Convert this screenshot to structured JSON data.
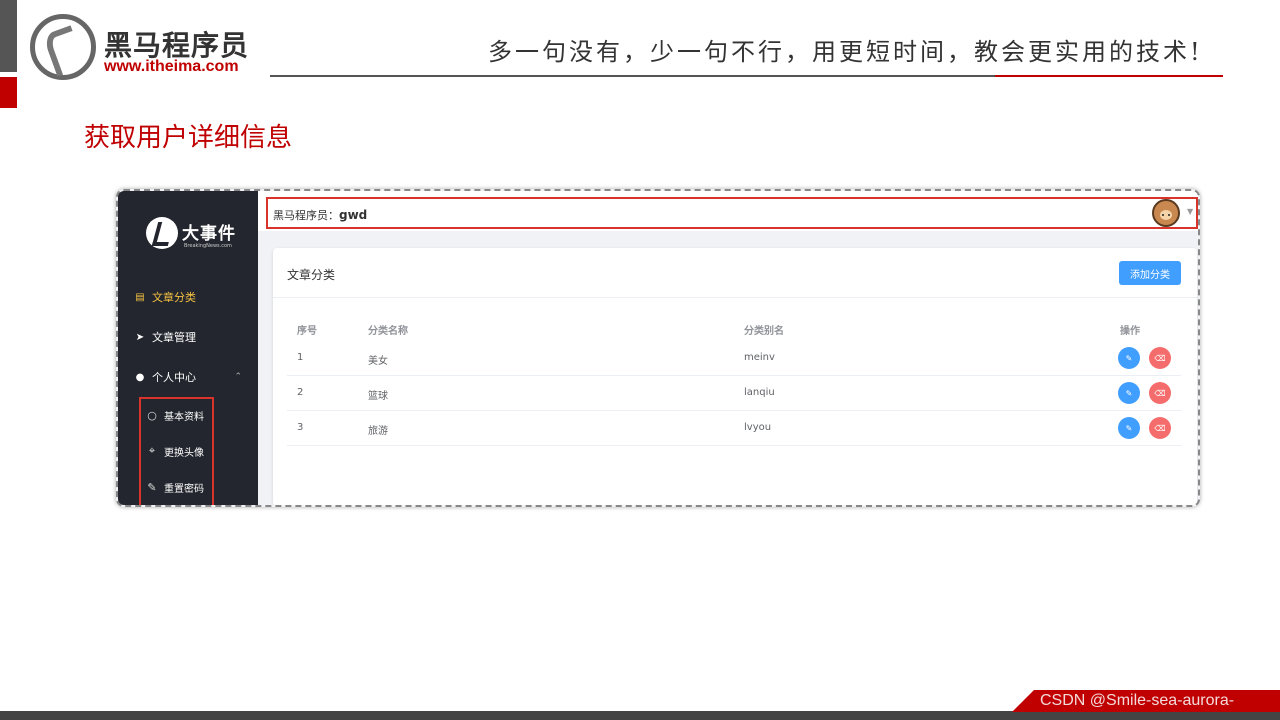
{
  "slide": {
    "brand_name": "黑马程序员",
    "brand_url": "www.itheima.com",
    "slogan": "多一句没有，少一句不行，用更短时间，教会更实用的技术!",
    "title": "获取用户详细信息",
    "watermark": "CSDN @Smile-sea-aurora-"
  },
  "app": {
    "brand": {
      "name": "大事件",
      "sub": "BreakingNews.com"
    },
    "sidebar": {
      "items": [
        {
          "label": "文章分类",
          "icon": "book-icon",
          "active": true
        },
        {
          "label": "文章管理",
          "icon": "paper-plane-icon",
          "active": false
        },
        {
          "label": "个人中心",
          "icon": "user-icon",
          "active": false,
          "expanded": true
        }
      ],
      "subitems": [
        {
          "label": "基本资料",
          "icon": "user-outline-icon"
        },
        {
          "label": "更换头像",
          "icon": "crop-icon"
        },
        {
          "label": "重置密码",
          "icon": "edit-pen-icon"
        }
      ]
    },
    "header": {
      "welcome_prefix": "黑马程序员：",
      "username": "gwd"
    },
    "card": {
      "title": "文章分类",
      "add_button": "添加分类",
      "columns": [
        "序号",
        "分类名称",
        "分类别名",
        "操作"
      ],
      "rows": [
        {
          "index": "1",
          "name": "美女",
          "alias": "meinv"
        },
        {
          "index": "2",
          "name": "篮球",
          "alias": "lanqiu"
        },
        {
          "index": "3",
          "name": "旅游",
          "alias": "lvyou"
        }
      ]
    },
    "colors": {
      "primary": "#409eff",
      "danger": "#f56c6c",
      "sidebar": "#23262e",
      "active": "#f5c242",
      "highlight": "#d9342b"
    }
  }
}
